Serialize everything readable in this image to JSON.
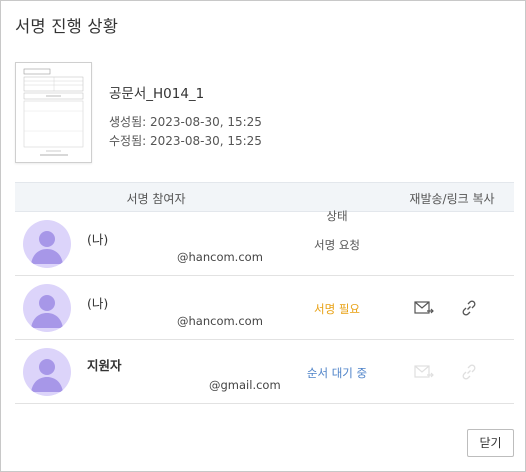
{
  "dialog": {
    "title": "서명 진행 상황",
    "close_label": "닫기"
  },
  "document": {
    "name": "공문서_H014_1",
    "created": "생성됨: 2023-08-30, 15:25",
    "modified": "수정됨: 2023-08-30, 15:25"
  },
  "table": {
    "headers": {
      "participant": "서명 참여자",
      "status": "상태",
      "resend": "재발송/링크 복사"
    },
    "rows": [
      {
        "name": "(나)",
        "email": "@hancom.com",
        "status": "서명 요청",
        "actions_visible": false
      },
      {
        "name": "(나)",
        "email": "@hancom.com",
        "status": "서명 필요",
        "actions_visible": true,
        "actions_enabled": true
      },
      {
        "name": "지원자",
        "email": "@gmail.com",
        "status": "순서 대기 중",
        "actions_visible": true,
        "actions_enabled": false
      }
    ]
  },
  "icons": {
    "avatar": "user-avatar-icon",
    "resend": "mail-send-icon",
    "copy_link": "link-icon"
  },
  "colors": {
    "status_needed": "#e8a114",
    "status_waiting": "#4d82c8",
    "avatar_bg": "#dcd4fa",
    "avatar_fg": "#a797e8",
    "header_bg": "#f2f5f8"
  }
}
